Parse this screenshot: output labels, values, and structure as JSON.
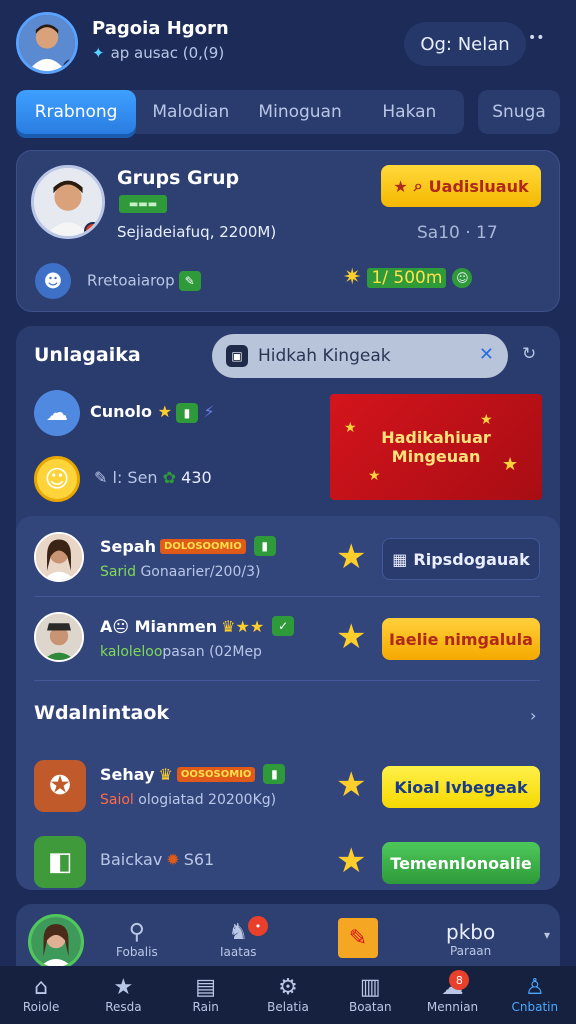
{
  "header": {
    "name": "Pagoia Hgorn",
    "subtitle": "ap ausac (0,(9)",
    "search_label": "Og: Nelan",
    "more": "••"
  },
  "tabs": [
    {
      "label": "Rrabnong",
      "active": true
    },
    {
      "label": "Malodian"
    },
    {
      "label": "Minoguan"
    },
    {
      "label": "Hakan"
    }
  ],
  "tab_extra": "Snuga",
  "group": {
    "title": "Grups Grup",
    "tag": "▬▬▬",
    "stats": "Sejiadeiafuq, 2200M)",
    "action": "Uadisluauk",
    "count": "Sa10 · 17",
    "row2_label": "Rretoaiarop",
    "row2_value": "1/ 500m"
  },
  "panel": {
    "title": "Unlagaika",
    "search_placeholder": "Hidkah Kingeak",
    "row_a_label": "Cunolo",
    "row_b_label": "l: Sen",
    "row_b_value": "430",
    "banner_line1": "Hadikahiuar",
    "banner_line2": "Mingeuan"
  },
  "list": [
    {
      "name": "Sepah",
      "badge": "DOLOSOOMIO",
      "meta_prefix": "Sarid",
      "meta": " Gonaarier/200/3)",
      "action": "Ripsdogauak",
      "style": "navy"
    },
    {
      "name": "A😐 Mianmen",
      "badge": "",
      "meta_prefix": "kaloleloo",
      "meta": "pasan (02Mep",
      "action": "Iaelie nimgalula",
      "style": "orange"
    }
  ],
  "section2": {
    "title": "Wdalnintaok"
  },
  "list2": [
    {
      "name": "Sehay",
      "badge": "OOSOSOMIO",
      "meta_prefix": "Saiol",
      "meta": " ologiatad 20200Kg)",
      "action": "Kioal Ivbegeak",
      "style": "yellow"
    },
    {
      "name": "Baickav",
      "badge": "",
      "meta_prefix": "",
      "meta": "S61",
      "action": "Temennlonoalie",
      "style": "green"
    }
  ],
  "footer_card": {
    "items": [
      {
        "label": "Fobalis",
        "icon": "pin-icon"
      },
      {
        "label": "Iaatas",
        "icon": "bell-icon",
        "badge": "•"
      },
      {
        "label": "",
        "icon": "note-icon"
      },
      {
        "label": "Paraan",
        "icon": "text-icon",
        "text": "pkbo"
      }
    ]
  },
  "bottom_nav": [
    {
      "label": "Roiole",
      "icon": "home-icon"
    },
    {
      "label": "Resda",
      "icon": "star-icon"
    },
    {
      "label": "Rain",
      "icon": "doc-icon"
    },
    {
      "label": "Belatia",
      "icon": "gear-icon"
    },
    {
      "label": "Boatan",
      "icon": "chart-icon"
    },
    {
      "label": "Mennian",
      "icon": "chat-icon",
      "badge": "8"
    },
    {
      "label": "Cnbatin",
      "icon": "person-icon",
      "active": true
    }
  ]
}
